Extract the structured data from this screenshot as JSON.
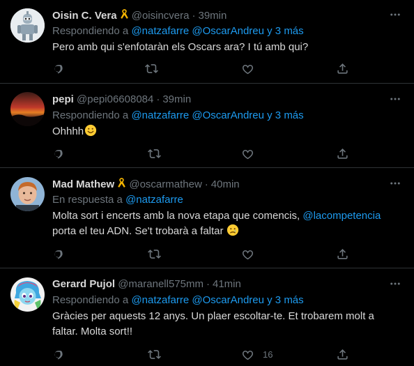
{
  "tweets": [
    {
      "name": "Oisin C. Vera",
      "badge": "ribbon-icon",
      "handle": "@oisincvera",
      "time": "39min",
      "reply_prefix": "Respondiendo a",
      "mentions": "@natzafarre @OscarAndreu y 3 más",
      "text": "Pero amb qui s'enfotaràn els Oscars ara? I tú amb qui?"
    },
    {
      "name": "pepi",
      "handle": "@pepi06608084",
      "time": "39min",
      "reply_prefix": "Respondiendo a",
      "mentions": "@natzafarre @OscarAndreu y 3 más",
      "text": "Ohhhh",
      "emoji": "smiling-face-icon"
    },
    {
      "name": "Mad Mathew",
      "badge": "ribbon-icon",
      "handle": "@oscarmathew",
      "time": "40min",
      "reply_prefix": "En respuesta a",
      "mentions": "@natzafarre",
      "text_part1": "Molta sort i encerts amb la nova etapa que comencis,",
      "text_mention": "@lacompetencia",
      "text_part2": "porta el teu ADN. Se't trobarà a faltar",
      "emoji": "crying-face-icon"
    },
    {
      "name": "Gerard Pujol",
      "handle": "@maranell575mm",
      "time": "41min",
      "reply_prefix": "Respondiendo a",
      "mentions": "@natzafarre @OscarAndreu y 3 más",
      "text": "Gràcies per aquests 12 anys. Un plaer escoltar-te. Et trobarem molt a faltar. Molta sort!!",
      "like_count": "16"
    }
  ],
  "separator": "·",
  "colors": {
    "background": "#000000",
    "text": "#d9d9d9",
    "secondary": "#6e767d",
    "link": "#1d9bf0",
    "ribbon": "#f5b400"
  }
}
